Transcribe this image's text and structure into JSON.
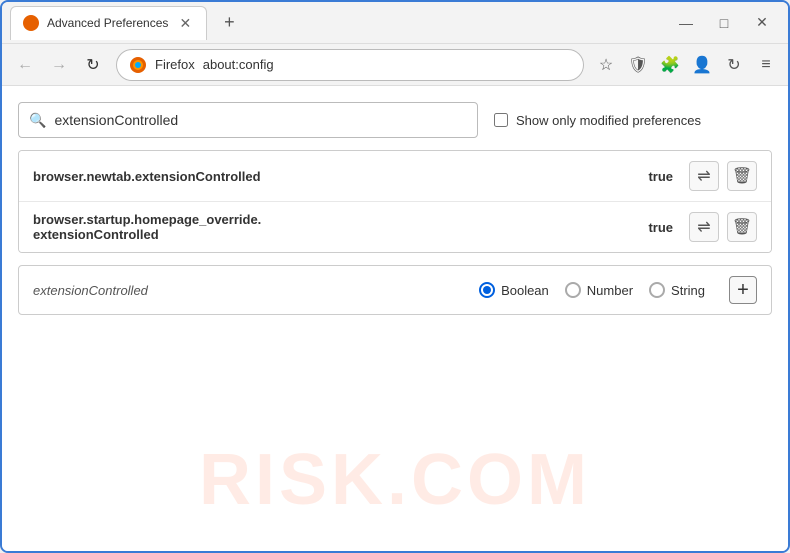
{
  "window": {
    "title": "Advanced Preferences",
    "new_tab_icon": "+",
    "controls": {
      "minimize": "—",
      "maximize": "□",
      "close": "✕"
    }
  },
  "toolbar": {
    "back_label": "←",
    "forward_label": "→",
    "reload_label": "↻",
    "browser_name": "Firefox",
    "address": "about:config",
    "star_icon": "☆",
    "shield_icon": "⛉",
    "extension_icon": "🧩",
    "profile_icon": "👤",
    "sync_icon": "↻",
    "menu_icon": "≡"
  },
  "search": {
    "placeholder": "extensionControlled",
    "value": "extensionControlled",
    "show_modified_label": "Show only modified preferences"
  },
  "results": [
    {
      "name": "browser.newtab.extensionControlled",
      "value": "true"
    },
    {
      "name_line1": "browser.startup.homepage_override.",
      "name_line2": "extensionControlled",
      "value": "true"
    }
  ],
  "new_pref": {
    "name": "extensionControlled",
    "type_options": [
      "Boolean",
      "Number",
      "String"
    ],
    "selected_type": "Boolean"
  },
  "watermark": "RISK.COM"
}
